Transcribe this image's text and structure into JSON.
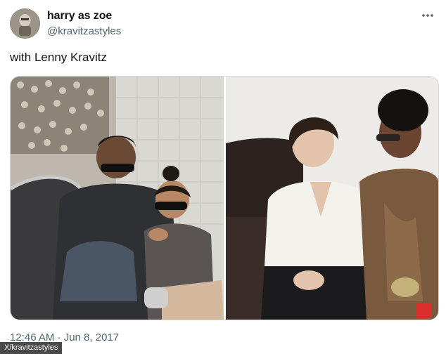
{
  "tweet": {
    "display_name": "harry as zoe",
    "handle": "@kravitzastyles",
    "text": "with Lenny Kravitz",
    "timestamp": "12:46 AM · Jun 8, 2017",
    "more_icon": "more-horizontal-icon"
  },
  "media": {
    "photo_left_icon": "photo-left",
    "photo_right_icon": "photo-right"
  },
  "credit": "X/kravitzastyles"
}
